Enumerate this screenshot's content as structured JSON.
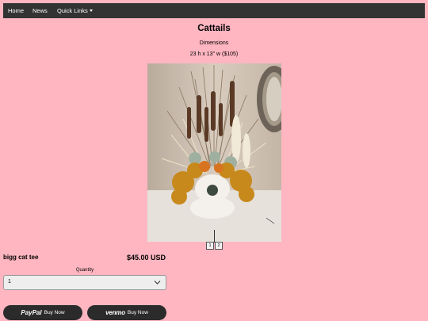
{
  "nav": {
    "home": "Home",
    "news": "News",
    "quick_links": "Quick Links"
  },
  "product": {
    "title": "Cattails",
    "dimensions_label": "Dimensions",
    "dimensions_value": "23 h x 13\" w ($105)",
    "name": "bigg cat tee",
    "price": "$45.00 USD"
  },
  "gallery": {
    "pages": [
      "1",
      "2"
    ],
    "image_icon": "cattail-arrangement-photo"
  },
  "quantity": {
    "label": "Quantity",
    "value": "1"
  },
  "payment": {
    "paypal_brand": "PayPal",
    "paypal_suffix": "Buy Now",
    "venmo_brand": "venmo",
    "venmo_suffix": "Buy Now"
  },
  "colors": {
    "background": "#ffb6c1",
    "navbar": "#333333",
    "button": "#2b2b2b"
  }
}
